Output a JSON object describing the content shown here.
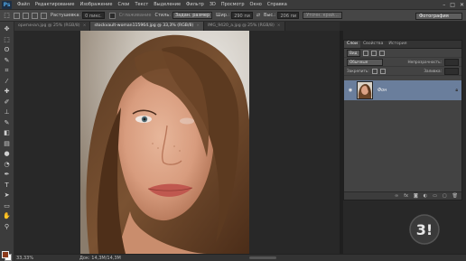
{
  "app": {
    "logo": "Ps"
  },
  "menu": [
    "Файл",
    "Редактирование",
    "Изображение",
    "Слои",
    "Текст",
    "Выделение",
    "Фильтр",
    "3D",
    "Просмотр",
    "Окно",
    "Справка"
  ],
  "window_controls": [
    "–",
    "□",
    "✕"
  ],
  "options_bar": {
    "feather_label": "Растушевка:",
    "feather_value": "0 пикс.",
    "smooth_label": "Сглаживание",
    "style_label": "Стиль:",
    "style_value": "Задан. размер",
    "width_label": "Шир.:",
    "width_value": "290 пи",
    "height_label": "Выс.:",
    "height_value": "206 пи",
    "refine_label": "Уточн. край...",
    "workspace": "Фотография"
  },
  "tabs": [
    {
      "label": "оригинал.jpg @ 25% (RGB/8)",
      "active": false
    },
    {
      "label": "stockvault-woman115964.jpg @ 33,3% (RGB/8)",
      "active": true
    },
    {
      "label": "IMG_9420_a.jpg @ 25% (RGB/8)",
      "active": false
    }
  ],
  "tools": [
    {
      "icon": "move-tool-icon",
      "glyph": "✥"
    },
    {
      "icon": "marquee-tool-icon",
      "glyph": "⬚"
    },
    {
      "icon": "lasso-tool-icon",
      "glyph": "ʘ"
    },
    {
      "icon": "quick-select-tool-icon",
      "glyph": "✎"
    },
    {
      "icon": "crop-tool-icon",
      "glyph": "⌗"
    },
    {
      "icon": "eyedropper-tool-icon",
      "glyph": "⁄"
    },
    {
      "icon": "healing-tool-icon",
      "glyph": "✚"
    },
    {
      "icon": "brush-tool-icon",
      "glyph": "✐"
    },
    {
      "icon": "stamp-tool-icon",
      "glyph": "⊥"
    },
    {
      "icon": "history-brush-tool-icon",
      "glyph": "✎"
    },
    {
      "icon": "eraser-tool-icon",
      "glyph": "◧"
    },
    {
      "icon": "gradient-tool-icon",
      "glyph": "▤"
    },
    {
      "icon": "blur-tool-icon",
      "glyph": "●"
    },
    {
      "icon": "dodge-tool-icon",
      "glyph": "◔"
    },
    {
      "icon": "pen-tool-icon",
      "glyph": "✒"
    },
    {
      "icon": "type-tool-icon",
      "glyph": "T"
    },
    {
      "icon": "path-select-tool-icon",
      "glyph": "➤"
    },
    {
      "icon": "shape-tool-icon",
      "glyph": "▭"
    },
    {
      "icon": "hand-tool-icon",
      "glyph": "✋"
    },
    {
      "icon": "zoom-tool-icon",
      "glyph": "⚲"
    }
  ],
  "colors": {
    "foreground": "#8b3a1a",
    "background": "#ffffff",
    "selected_layer": "#6a7e9c"
  },
  "status": {
    "zoom": "33,33%",
    "doc": "Док: 14,3M/14,3M"
  },
  "layers_panel": {
    "tabs": [
      "Слои",
      "Свойства",
      "История"
    ],
    "filter_label": "Вид",
    "blend_mode": "Обычные",
    "opacity_label": "Непрозрачность:",
    "lock_label": "Закрепить:",
    "fill_label": "Заливка:",
    "layer_name": "Фон"
  },
  "watermark": "3!"
}
